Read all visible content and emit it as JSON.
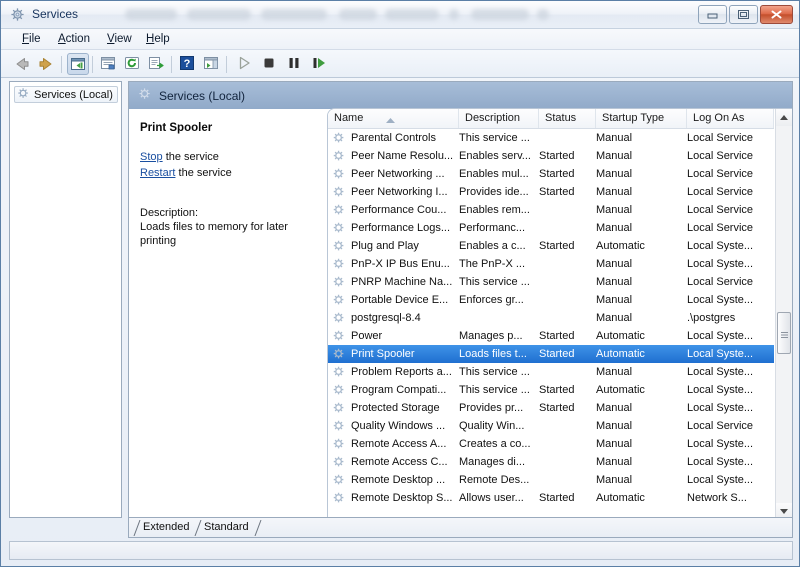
{
  "window": {
    "title": "Services",
    "title_icon": "gear-icon",
    "controls": {
      "minimize": "Minimize",
      "maximize": "Restore",
      "close": "Close"
    }
  },
  "menu": {
    "items": [
      {
        "label": "File",
        "accel": "F"
      },
      {
        "label": "Action",
        "accel": "A"
      },
      {
        "label": "View",
        "accel": "V"
      },
      {
        "label": "Help",
        "accel": "H"
      }
    ]
  },
  "toolbar": {
    "buttons": [
      {
        "name": "back-arrow-icon",
        "tip": "Back"
      },
      {
        "name": "forward-arrow-icon",
        "tip": "Forward"
      },
      {
        "name": "show-hide-console-tree-icon",
        "tip": "Show/Hide Console Tree"
      },
      {
        "name": "properties-icon",
        "tip": "Properties"
      },
      {
        "name": "refresh-icon",
        "tip": "Refresh"
      },
      {
        "name": "export-list-icon",
        "tip": "Export List"
      },
      {
        "name": "help-icon",
        "tip": "Help"
      },
      {
        "name": "show-hide-action-pane-icon",
        "tip": "Show/Hide Action Pane"
      },
      {
        "name": "start-service-icon",
        "tip": "Start Service"
      },
      {
        "name": "stop-service-icon",
        "tip": "Stop Service"
      },
      {
        "name": "pause-service-icon",
        "tip": "Pause Service"
      },
      {
        "name": "restart-service-icon",
        "tip": "Restart Service"
      }
    ]
  },
  "left_pane": {
    "root_label": "Services (Local)",
    "root_icon": "gear-icon"
  },
  "details_pane": {
    "header_label": "Services (Local)",
    "header_icon": "gear-icon",
    "service_name": "Print Spooler",
    "links": [
      {
        "link": "Stop",
        "rest": " the service"
      },
      {
        "link": "Restart",
        "rest": " the service"
      }
    ],
    "description_label": "Description:",
    "description_text": "Loads files to memory for later printing"
  },
  "list": {
    "sort_column": "Name",
    "sort_direction": "ascending",
    "columns": [
      {
        "key": "name",
        "label": "Name"
      },
      {
        "key": "description",
        "label": "Description"
      },
      {
        "key": "status",
        "label": "Status"
      },
      {
        "key": "startup",
        "label": "Startup Type"
      },
      {
        "key": "logon",
        "label": "Log On As"
      }
    ],
    "selected_row_index": 12,
    "rows": [
      {
        "name": "Parental Controls",
        "description": "This service ...",
        "status": "",
        "startup": "Manual",
        "logon": "Local Service"
      },
      {
        "name": "Peer Name Resolu...",
        "description": "Enables serv...",
        "status": "Started",
        "startup": "Manual",
        "logon": "Local Service"
      },
      {
        "name": "Peer Networking ...",
        "description": "Enables mul...",
        "status": "Started",
        "startup": "Manual",
        "logon": "Local Service"
      },
      {
        "name": "Peer Networking I...",
        "description": "Provides ide...",
        "status": "Started",
        "startup": "Manual",
        "logon": "Local Service"
      },
      {
        "name": "Performance Cou...",
        "description": "Enables rem...",
        "status": "",
        "startup": "Manual",
        "logon": "Local Service"
      },
      {
        "name": "Performance Logs...",
        "description": "Performanc...",
        "status": "",
        "startup": "Manual",
        "logon": "Local Service"
      },
      {
        "name": "Plug and Play",
        "description": "Enables a c...",
        "status": "Started",
        "startup": "Automatic",
        "logon": "Local Syste..."
      },
      {
        "name": "PnP-X IP Bus Enu...",
        "description": "The PnP-X ...",
        "status": "",
        "startup": "Manual",
        "logon": "Local Syste..."
      },
      {
        "name": "PNRP Machine Na...",
        "description": "This service ...",
        "status": "",
        "startup": "Manual",
        "logon": "Local Service"
      },
      {
        "name": "Portable Device E...",
        "description": "Enforces gr...",
        "status": "",
        "startup": "Manual",
        "logon": "Local Syste..."
      },
      {
        "name": "postgresql-8.4",
        "description": "",
        "status": "",
        "startup": "Manual",
        "logon": ".\\postgres"
      },
      {
        "name": "Power",
        "description": "Manages p...",
        "status": "Started",
        "startup": "Automatic",
        "logon": "Local Syste..."
      },
      {
        "name": "Print Spooler",
        "description": "Loads files t...",
        "status": "Started",
        "startup": "Automatic",
        "logon": "Local Syste..."
      },
      {
        "name": "Problem Reports a...",
        "description": "This service ...",
        "status": "",
        "startup": "Manual",
        "logon": "Local Syste..."
      },
      {
        "name": "Program Compati...",
        "description": "This service ...",
        "status": "Started",
        "startup": "Automatic",
        "logon": "Local Syste..."
      },
      {
        "name": "Protected Storage",
        "description": "Provides pr...",
        "status": "Started",
        "startup": "Manual",
        "logon": "Local Syste..."
      },
      {
        "name": "Quality Windows ...",
        "description": "Quality Win...",
        "status": "",
        "startup": "Manual",
        "logon": "Local Service"
      },
      {
        "name": "Remote Access A...",
        "description": "Creates a co...",
        "status": "",
        "startup": "Manual",
        "logon": "Local Syste..."
      },
      {
        "name": "Remote Access C...",
        "description": "Manages di...",
        "status": "",
        "startup": "Manual",
        "logon": "Local Syste..."
      },
      {
        "name": "Remote Desktop ...",
        "description": "Remote Des...",
        "status": "",
        "startup": "Manual",
        "logon": "Local Syste..."
      },
      {
        "name": "Remote Desktop S...",
        "description": "Allows user...",
        "status": "Started",
        "startup": "Automatic",
        "logon": "Network S..."
      }
    ]
  },
  "tabs": {
    "items": [
      {
        "label": "Extended",
        "active": false
      },
      {
        "label": "Standard",
        "active": true
      }
    ]
  },
  "colors": {
    "selection_blue": "#1f6fd0",
    "header_blue": "#91aac9",
    "link_blue": "#1a4fa0",
    "close_red": "#c44f2c"
  }
}
